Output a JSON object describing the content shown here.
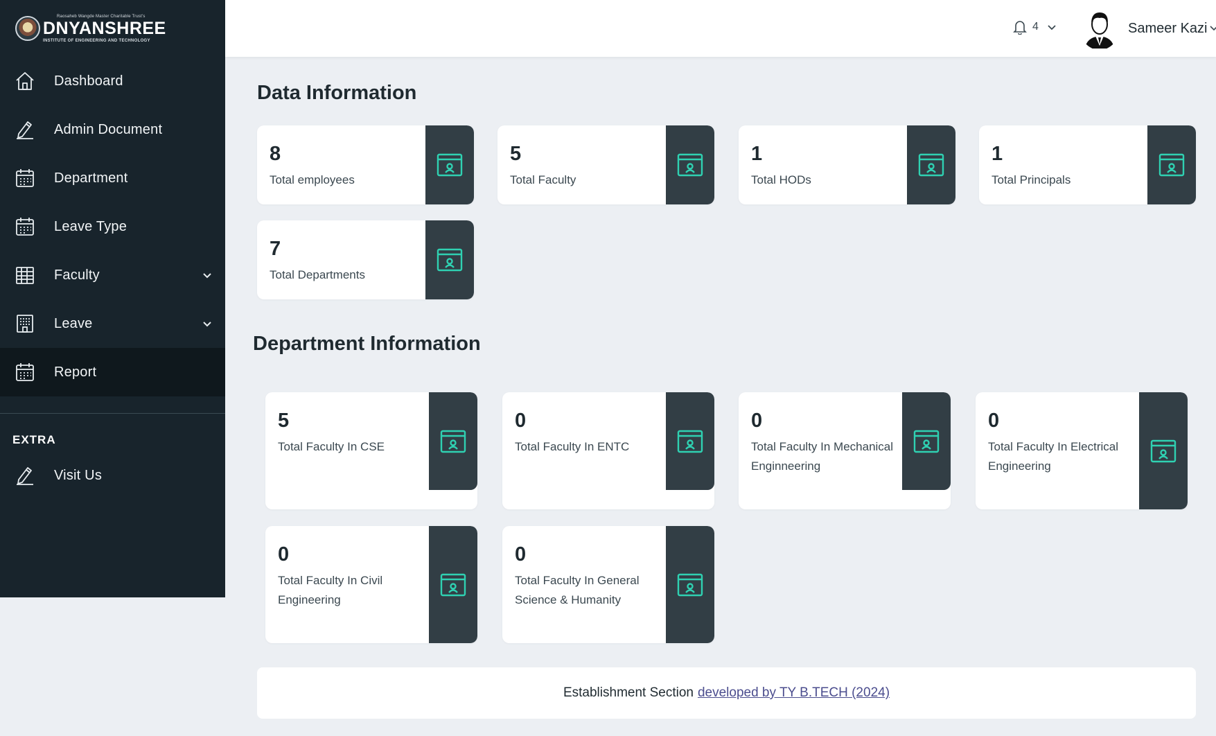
{
  "brand": {
    "tagline": "Raosaheb Wangde Master Charitable Trust's",
    "name": "DNYANSHREE",
    "subtitle": "INSTITUTE OF ENGINEERING AND TECHNOLOGY"
  },
  "sidebar": {
    "items": [
      {
        "label": "Dashboard",
        "icon": "home-icon"
      },
      {
        "label": "Admin Document",
        "icon": "pen-icon"
      },
      {
        "label": "Department",
        "icon": "calendar-icon"
      },
      {
        "label": "Leave Type",
        "icon": "calendar-icon"
      },
      {
        "label": "Faculty",
        "icon": "table-icon"
      },
      {
        "label": "Leave",
        "icon": "building-icon"
      },
      {
        "label": "Report",
        "icon": "calendar-icon"
      }
    ],
    "extra_heading": "EXTRA",
    "extra_items": [
      {
        "label": "Visit Us",
        "icon": "pen-icon"
      }
    ]
  },
  "header": {
    "notification_count": "4",
    "username": "Sameer Kazi"
  },
  "data_section": {
    "title": "Data Information",
    "cards": [
      {
        "value": "8",
        "label": "Total employees"
      },
      {
        "value": "5",
        "label": "Total Faculty"
      },
      {
        "value": "1",
        "label": "Total HODs"
      },
      {
        "value": "1",
        "label": "Total Principals"
      },
      {
        "value": "7",
        "label": "Total Departments"
      }
    ]
  },
  "department_section": {
    "title": "Department Information",
    "cards": [
      {
        "value": "5",
        "label": "Total Faculty In CSE"
      },
      {
        "value": "0",
        "label": "Total Faculty In ENTC"
      },
      {
        "value": "0",
        "label": "Total Faculty In Mechanical Enginneering"
      },
      {
        "value": "0",
        "label": "Total Faculty In Electrical Engineering"
      },
      {
        "value": "0",
        "label": "Total Faculty In Civil Engineering"
      },
      {
        "value": "0",
        "label": "Total Faculty In General Science & Humanity"
      }
    ]
  },
  "footer": {
    "text": "Establishment Section",
    "link_text": "developed by TY B.TECH (2024)"
  },
  "colors": {
    "sidebar_bg": "#18242c",
    "icon_panel": "#323e45",
    "accent": "#2fd1b2",
    "page_bg": "#eceff3"
  }
}
